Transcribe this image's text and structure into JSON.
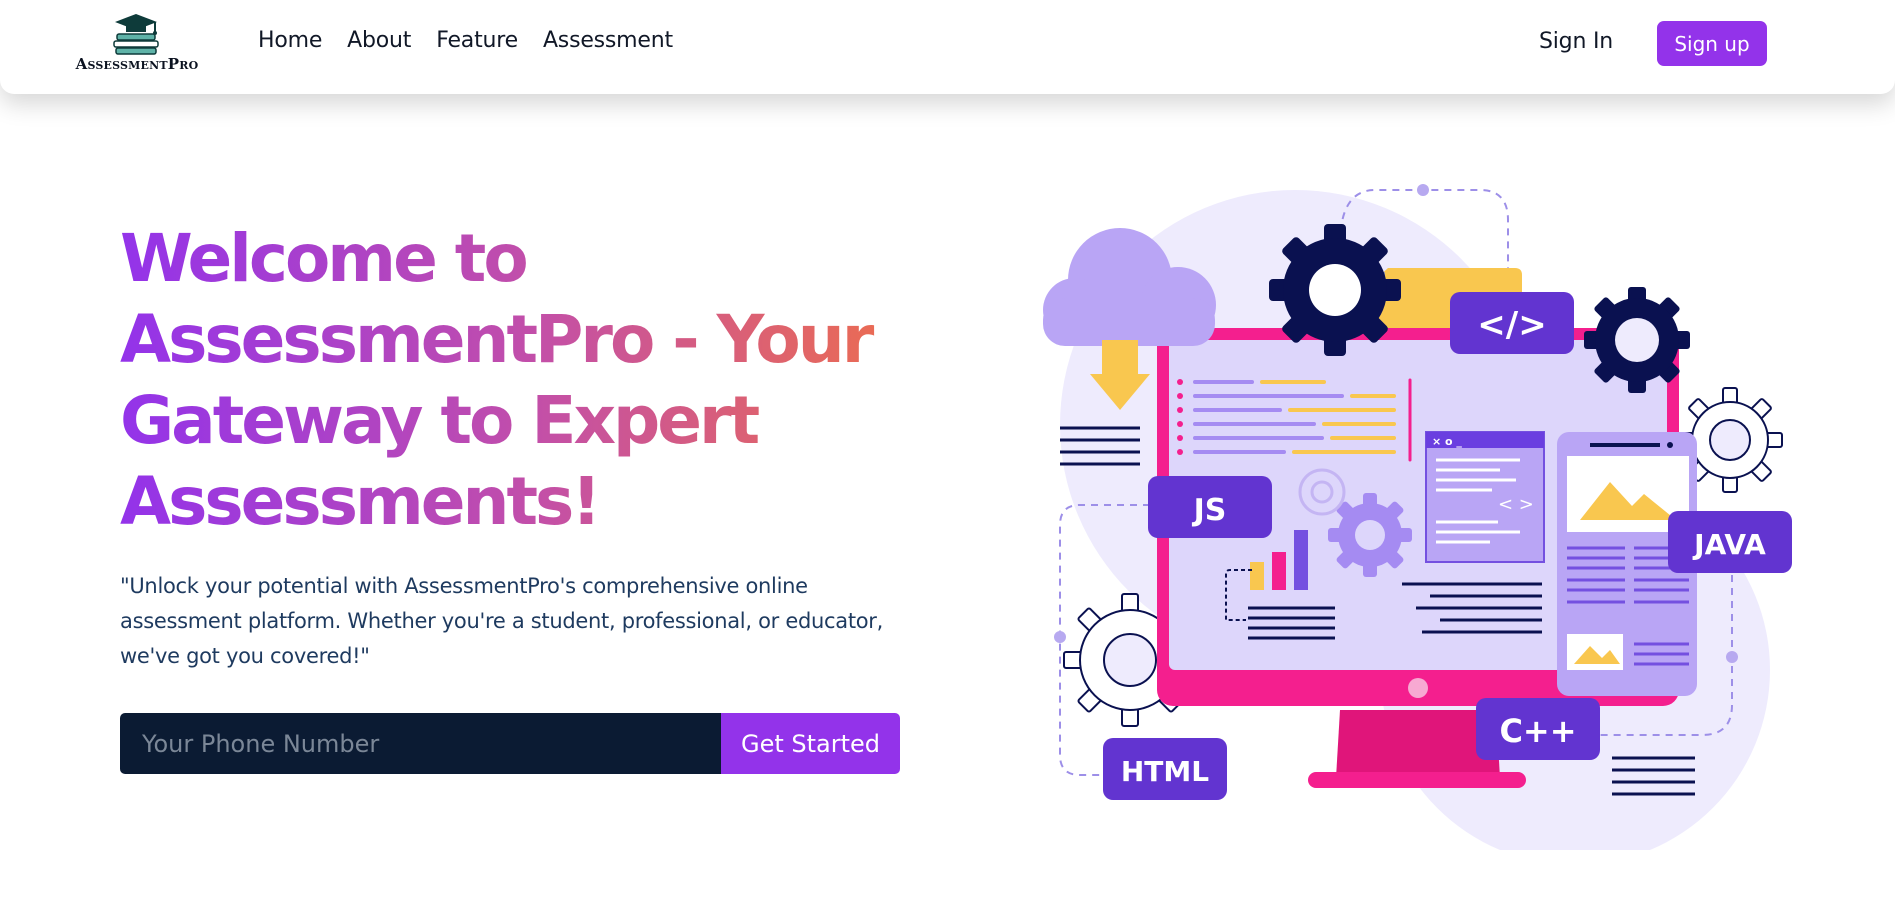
{
  "brand": {
    "name": "AssessmentPro"
  },
  "nav": {
    "links": [
      {
        "label": "Home"
      },
      {
        "label": "About"
      },
      {
        "label": "Feature"
      },
      {
        "label": "Assessment"
      }
    ],
    "sign_in": "Sign In",
    "sign_up": "Sign up"
  },
  "hero": {
    "title": "Welcome to AssessmentPro - Your Gateway to Expert Assessments!",
    "description": "\"Unlock your potential with AssessmentPro's comprehensive online assessment platform. Whether you're a student, professional, or educator, we've got you covered!\"",
    "phone_placeholder": "Your Phone Number",
    "cta": "Get Started"
  },
  "illustration": {
    "tags": {
      "code": "</>",
      "js": "JS",
      "java": "JAVA",
      "html": "HTML",
      "cpp": "C++"
    },
    "window_controls": "× o _"
  },
  "colors": {
    "accent": "#9333ea",
    "input_bg": "#0b1b33",
    "monitor": "#f41f8e",
    "navy": "#0a1150",
    "tag": "#6234d0",
    "yellow": "#f9c74f",
    "lavender": "#eeebfd"
  }
}
